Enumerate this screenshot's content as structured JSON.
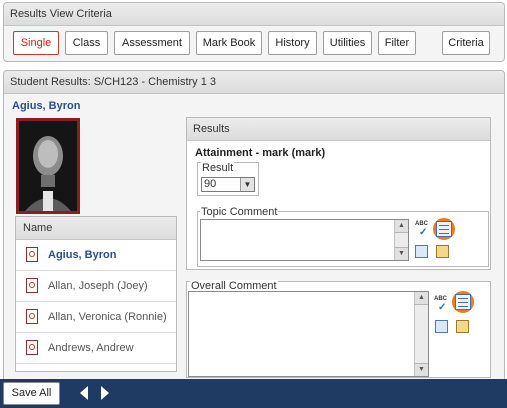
{
  "criteria": {
    "title": "Results View Criteria",
    "tabs": [
      {
        "label": "Single",
        "active": true
      },
      {
        "label": "Class"
      },
      {
        "label": "Assessment"
      },
      {
        "label": "Mark Book"
      },
      {
        "label": "History"
      },
      {
        "label": "Utilities"
      },
      {
        "label": "Filter"
      }
    ],
    "criteria_label": "Criteria"
  },
  "results": {
    "title": "Student Results: S/CH123 - Chemistry 1 3",
    "student_name": "Agius, Byron",
    "list": {
      "header": "Name",
      "students": [
        {
          "name": "Agius, Byron",
          "current": true
        },
        {
          "name": "Allan, Joseph (Joey)"
        },
        {
          "name": "Allan, Veronica (Ronnie)"
        },
        {
          "name": "Andrews, Andrew"
        }
      ]
    },
    "results_box": {
      "header": "Results",
      "attainment": "Attainment - mark  (mark)",
      "result_label": "Result",
      "result_value": "90",
      "topic_comment_label": "Topic Comment"
    },
    "overall_comment_label": "Overall Comment"
  },
  "footer": {
    "save_all": "Save All"
  },
  "colors": {
    "accent_red": "#c81e1e",
    "name_blue": "#2a4e8f",
    "footer_navy": "#1f3b63",
    "highlight_orange": "#f07a1a"
  }
}
